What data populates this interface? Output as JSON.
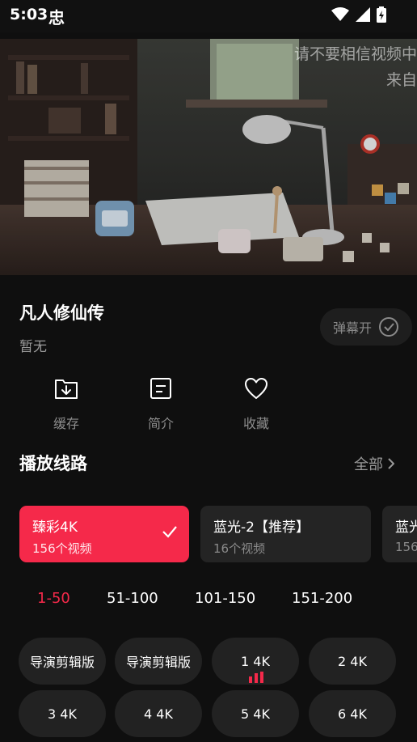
{
  "status_bar": {
    "time": "5:03",
    "app_glyph": "忠"
  },
  "video": {
    "danmaku": [
      "请不要相信视频中",
      "来自"
    ]
  },
  "info": {
    "title": "凡人修仙传",
    "subtitle": "暂无",
    "danmaku_toggle_label": "弹幕开"
  },
  "actions": [
    {
      "label": "缓存",
      "icon": "download-icon"
    },
    {
      "label": "简介",
      "icon": "info-icon"
    },
    {
      "label": "收藏",
      "icon": "heart-icon"
    }
  ],
  "sources_section": {
    "title": "播放线路",
    "all_label": "全部",
    "sources": [
      {
        "name": "臻彩4K",
        "count": "156个视频",
        "active": true
      },
      {
        "name": "蓝光-2【推荐】",
        "count": "16个视频",
        "active": false
      },
      {
        "name": "蓝光",
        "count": "156",
        "active": false
      }
    ]
  },
  "ranges": [
    "1-50",
    "51-100",
    "101-150",
    "151-200"
  ],
  "episodes": [
    "导演剪辑版",
    "导演剪辑版",
    "1 4K",
    "2 4K",
    "3 4K",
    "4 4K",
    "5 4K",
    "6 4K"
  ],
  "colors": {
    "accent": "#f5294a",
    "background": "#0f0f0f",
    "chip": "#222222"
  }
}
